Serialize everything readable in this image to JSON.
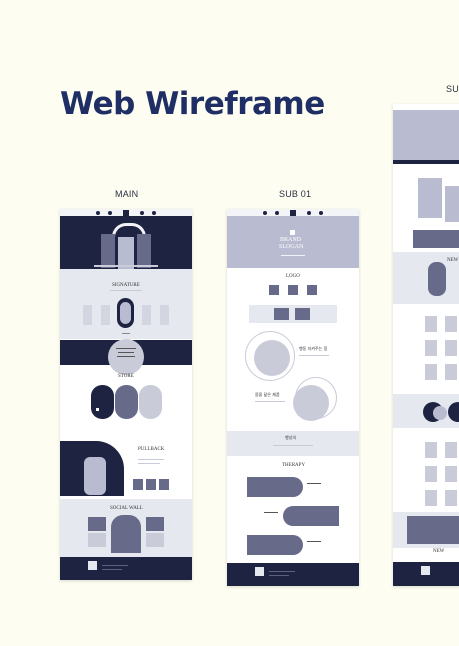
{
  "page": {
    "title": "Web Wireframe"
  },
  "labels": {
    "main": "MAIN",
    "sub01": "SUB 01",
    "sub02": "SUB"
  },
  "colors": {
    "background": "#fdfdf1",
    "title": "#1f2f66",
    "navy": "#1e2341",
    "gray_blue": "#676a88",
    "light": "#e6e8ef"
  },
  "main": {
    "signature": "SIGNATURE",
    "store": "STORE",
    "pullback": "PULLBACK",
    "social": "SOCIAL WALL"
  },
  "sub01": {
    "hero_line1": "BRAND",
    "hero_line2": "SLOGAN",
    "logo": "LOGO",
    "story_1": "행동 지켜주는 힘",
    "story_2": "몸을 닮은 제품",
    "band_text": "행성의",
    "therapy": "THERAPY"
  },
  "sub02": {
    "new": "NEW"
  }
}
